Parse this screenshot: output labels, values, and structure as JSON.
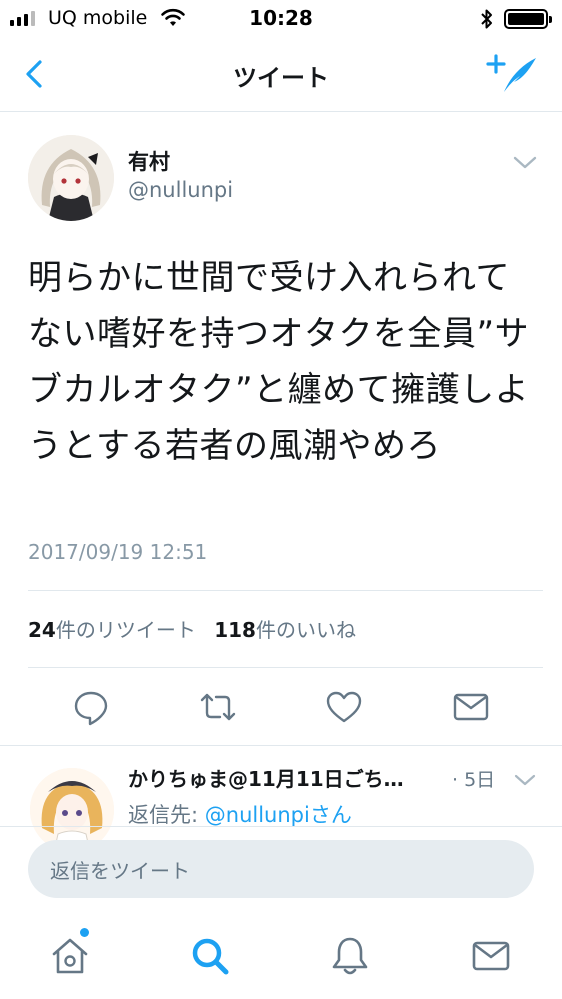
{
  "status_bar": {
    "carrier": "UQ mobile",
    "time": "10:28",
    "battery_level": 1.0
  },
  "nav": {
    "title": "ツイート",
    "back_icon": "chevron-left-icon",
    "compose_icon": "compose-tweet-icon"
  },
  "tweet": {
    "author_name": "有村",
    "author_handle": "@nullunpi",
    "text": "明らかに世間で受け入れられてない嗜好を持つオタクを全員”サブカルオタク”と纏めて擁護しようとする若者の風潮やめろ",
    "timestamp": "2017/09/19 12:51",
    "retweet_count": "24",
    "retweet_label": "件のリツイート",
    "like_count": "118",
    "like_label": "件のいいね",
    "actions": [
      "reply-icon",
      "retweet-icon",
      "like-icon",
      "share-icon"
    ]
  },
  "reply": {
    "author_name": "かりちゅま@11月11日ごち…",
    "time": "· 5日",
    "reply_to_prefix": "返信先: ",
    "reply_to_mention": "@nullunpi",
    "reply_to_suffix": "さん"
  },
  "composer": {
    "placeholder": "返信をツイート"
  },
  "tabbar": {
    "tabs": [
      "home-icon",
      "search-icon",
      "notifications-icon",
      "messages-icon"
    ],
    "active": "search-icon"
  },
  "colors": {
    "accent": "#1da1f2",
    "text": "#14171a",
    "secondary": "#657786",
    "border": "#e1e8ed",
    "composer_bg": "#e6ecf0"
  }
}
